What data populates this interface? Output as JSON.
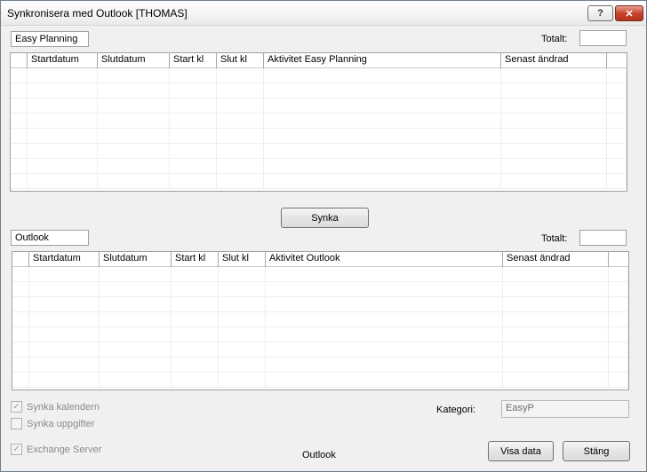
{
  "window": {
    "title": "Synkronisera med Outlook [THOMAS]",
    "help_glyph": "?",
    "close_glyph": "✕"
  },
  "easy_planning": {
    "label": "Easy Planning",
    "total_label": "Totalt:",
    "total_value": "",
    "columns": [
      "",
      "Startdatum",
      "Slutdatum",
      "Start kl",
      "Slut kl",
      "Aktivitet Easy Planning",
      "Senast ändrad",
      ""
    ],
    "rows": [
      [],
      [],
      [],
      [],
      [],
      [],
      [],
      []
    ]
  },
  "sync_button": "Synka",
  "outlook": {
    "label": "Outlook",
    "total_label": "Totalt:",
    "total_value": "",
    "columns": [
      "",
      "Startdatum",
      "Slutdatum",
      "Start kl",
      "Slut kl",
      "Aktivitet Outlook",
      "Senast ändrad",
      ""
    ],
    "rows": [
      [],
      [],
      [],
      [],
      [],
      [],
      [],
      []
    ]
  },
  "options": {
    "sync_calendar": {
      "label": "Synka kalendern",
      "checked": true,
      "enabled": false
    },
    "sync_tasks": {
      "label": "Synka uppgifter",
      "checked": false,
      "enabled": false
    },
    "exchange_server": {
      "label": "Exchange Server",
      "checked": true,
      "enabled": false
    }
  },
  "kategori": {
    "label": "Kategori:",
    "value": "EasyP"
  },
  "status_text": "Outlook",
  "buttons": {
    "show_data": "Visa data",
    "close": "Stäng"
  }
}
